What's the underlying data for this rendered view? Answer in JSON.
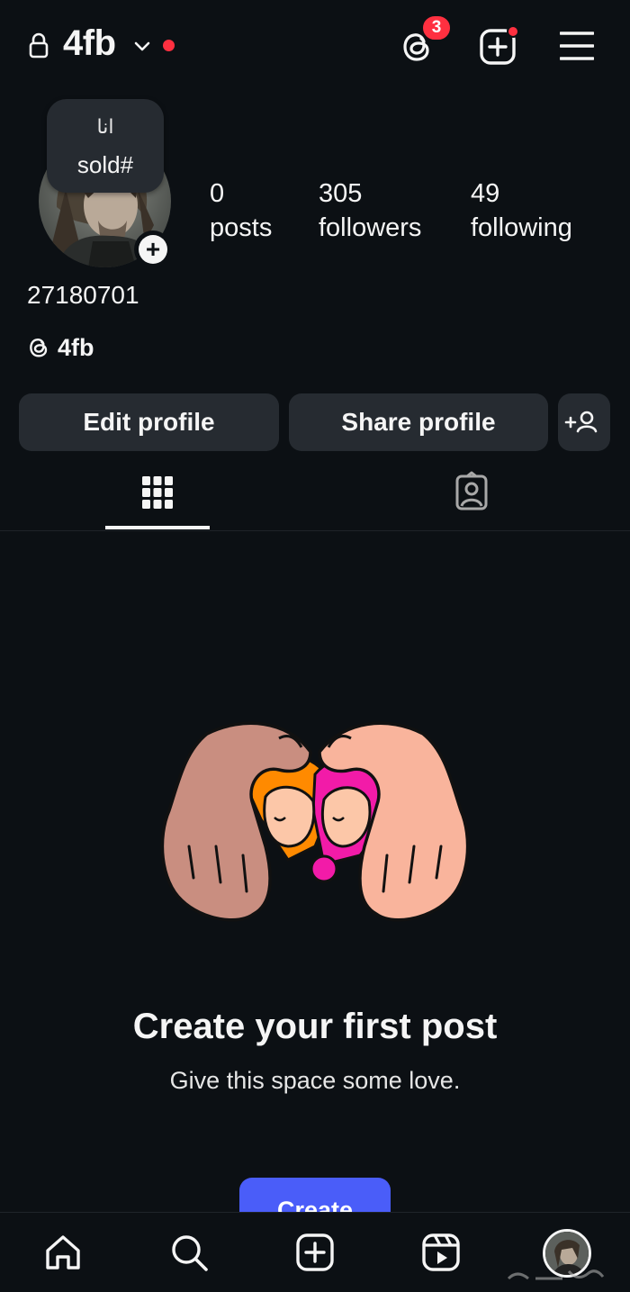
{
  "header": {
    "username": "4fb",
    "threads_badge_count": "3"
  },
  "profile": {
    "note_line1": "انا",
    "note_line2": "sold#",
    "stats": [
      {
        "number": "0",
        "label": "posts"
      },
      {
        "number": "305",
        "label": "followers"
      },
      {
        "number": "49",
        "label": "following"
      }
    ],
    "bio": "27180701",
    "threads_handle": "4fb"
  },
  "buttons": {
    "edit_profile": "Edit profile",
    "share_profile": "Share profile"
  },
  "empty_state": {
    "title": "Create your first post",
    "subtitle": "Give this space some love.",
    "create_button": "Create"
  },
  "icons": {
    "lock": "lock-icon",
    "chevron": "chevron-down-icon",
    "threads": "threads-icon",
    "create": "create-post-icon",
    "menu": "hamburger-menu-icon",
    "add_person": "add-person-icon",
    "grid": "grid-icon",
    "tagged": "tagged-icon",
    "home": "home-icon",
    "search": "search-icon",
    "new_post": "new-post-icon",
    "reels": "reels-icon"
  },
  "colors": {
    "background": "#0c1014",
    "button_bg": "#262b31",
    "notification_red": "#ff3040",
    "primary_blue": "#4a5df9"
  }
}
